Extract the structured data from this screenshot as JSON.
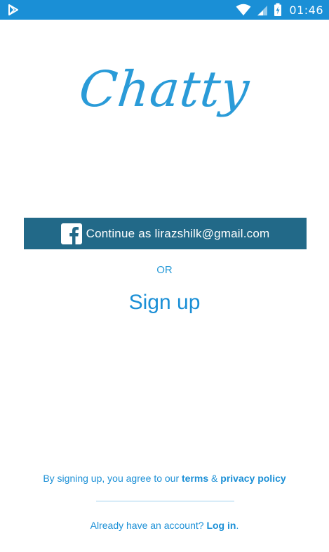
{
  "status_bar": {
    "time": "01:46",
    "left_icon": "play-store-icon",
    "right_icons": [
      "wifi-icon",
      "cell-signal-icon",
      "battery-charging-icon"
    ],
    "background_color": "#1a8fd6"
  },
  "logo": {
    "text": "Chatty",
    "color": "#2a9bd8"
  },
  "facebook_button": {
    "label": "Continue as lirazshilk@gmail.com",
    "icon": "facebook-icon",
    "background_color": "#226988"
  },
  "or_label": "OR",
  "signup_label": "Sign up",
  "terms": {
    "prefix": "By signing up, you agree to our ",
    "terms_link": "terms",
    "separator": " & ",
    "privacy_link": "privacy policy"
  },
  "login": {
    "prefix": "Already have an account? ",
    "link": "Log in",
    "suffix": "."
  }
}
